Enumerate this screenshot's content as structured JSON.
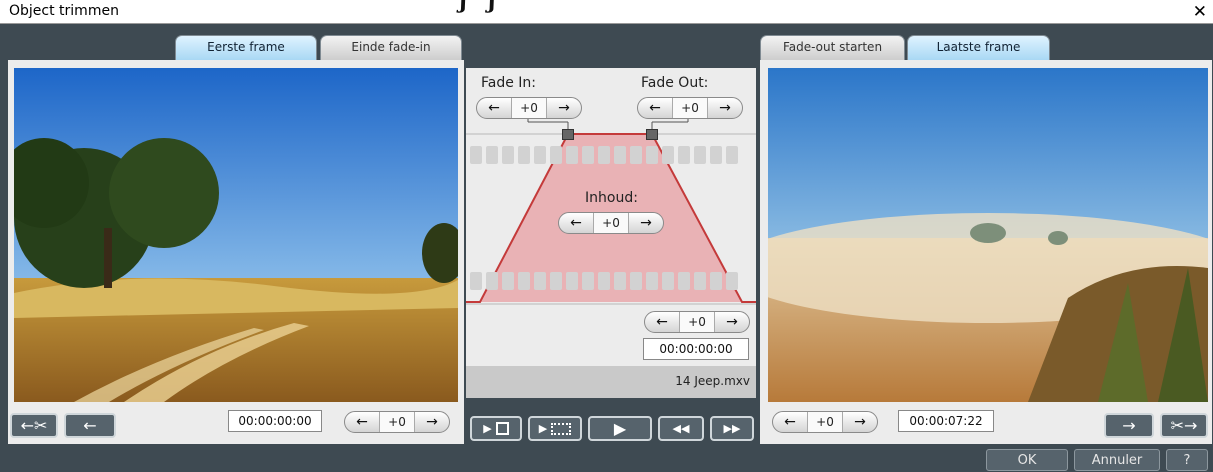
{
  "window": {
    "title": "Object trimmen",
    "overlay_fragment": "ʃʼ ʃ"
  },
  "left": {
    "tabs": [
      {
        "label": "Eerste frame",
        "active": true
      },
      {
        "label": "Einde fade-in",
        "active": false
      }
    ],
    "timecode": "00:00:00:00",
    "stepper": {
      "value": "+0"
    }
  },
  "right": {
    "tabs": [
      {
        "label": "Fade-out starten",
        "active": false
      },
      {
        "label": "Laatste frame",
        "active": true
      }
    ],
    "timecode": "00:00:07:22",
    "stepper": {
      "value": "+0"
    }
  },
  "center": {
    "fade_in": {
      "label": "Fade In:",
      "value": "+0"
    },
    "fade_out": {
      "label": "Fade Out:",
      "value": "+0"
    },
    "content": {
      "label": "Inhoud:",
      "value": "+0"
    },
    "stepper": {
      "value": "+0"
    },
    "timecode": "00:00:00:00",
    "filename": "14 Jeep.mxv"
  },
  "footer": {
    "ok_label": "OK",
    "cancel_label": "Annuler",
    "help_label": "?"
  },
  "icons": {
    "arrow_left": "←",
    "arrow_right": "→",
    "play": "▶",
    "rewind": "◀◀",
    "fast_forward": "▶▶",
    "cut": "✂"
  },
  "colors": {
    "accent_tab": "#a9d8f4",
    "fade_area": "#e8a4a8",
    "fade_line": "#c43a3a",
    "dark_bg": "#3e4a52"
  }
}
